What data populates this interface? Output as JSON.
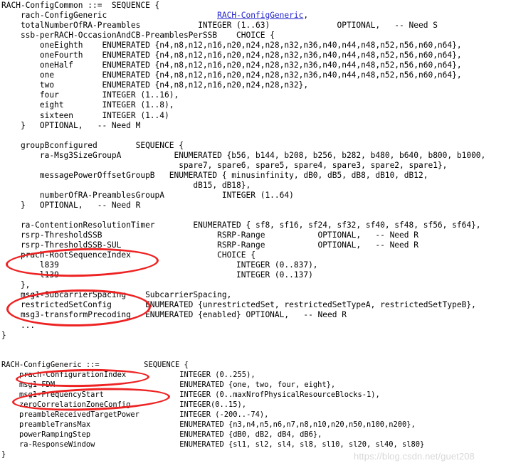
{
  "document": {
    "kind": "asn1-specification",
    "watermark": "https://blog.csdn.net/guet208",
    "annotation_color": "#ee2222",
    "link_color": "#2222cc",
    "text_color": "#000000",
    "background_color": "#ffffff"
  },
  "blocks": {
    "rach_config_common": {
      "name": "RACH-ConfigCommon",
      "lines": [
        "RACH-ConfigCommon ::=  SEQUENCE {",
        "    rach-ConfigGeneric                       ",
        "    totalNumberOfRA-Preambles            INTEGER (1..63)              OPTIONAL,   -- Need S",
        "    ssb-perRACH-OccasionAndCB-PreamblesPerSSB    CHOICE {",
        "        oneEighth    ENUMERATED {n4,n8,n12,n16,n20,n24,n28,n32,n36,n40,n44,n48,n52,n56,n60,n64},",
        "        oneFourth    ENUMERATED {n4,n8,n12,n16,n20,n24,n28,n32,n36,n40,n44,n48,n52,n56,n60,n64},",
        "        oneHalf      ENUMERATED {n4,n8,n12,n16,n20,n24,n28,n32,n36,n40,n44,n48,n52,n56,n60,n64},",
        "        one          ENUMERATED {n4,n8,n12,n16,n20,n24,n28,n32,n36,n40,n44,n48,n52,n56,n60,n64},",
        "        two          ENUMERATED {n4,n8,n12,n16,n20,n24,n28,n32},",
        "        four         INTEGER (1..16),",
        "        eight        INTEGER (1..8),",
        "        sixteen      INTEGER (1..4)",
        "    }   OPTIONAL,   -- Need M",
        "",
        "    groupBconfigured        SEQUENCE {",
        "        ra-Msg3SizeGroupA           ENUMERATED {b56, b144, b208, b256, b282, b480, b640, b800, b1000,",
        "                                     spare7, spare6, spare5, spare4, spare3, spare2, spare1},",
        "        messagePowerOffsetGroupB   ENUMERATED { minusinfinity, dB0, dB5, dB8, dB10, dB12,",
        "                                        dB15, dB18},",
        "        numberOfRA-PreamblesGroupA            INTEGER (1..64)",
        "    }   OPTIONAL,   -- Need R",
        "",
        "    ra-ContentionResolutionTimer        ENUMERATED { sf8, sf16, sf24, sf32, sf40, sf48, sf56, sf64},",
        "    rsrp-ThresholdSSB                        RSRP-Range           OPTIONAL,   -- Need R",
        "    rsrp-ThresholdSSB-SUL                    RSRP-Range           OPTIONAL,   -- Need R",
        "    prach-RootSequenceIndex                  CHOICE {",
        "        l839                                     INTEGER (0..837),",
        "        l139                                     INTEGER (0..137)",
        "    },",
        "    msg1-SubcarrierSpacing    SubcarrierSpacing,",
        "    restrictedSetConfig       ENUMERATED {unrestrictedSet, restrictedSetTypeA, restrictedSetTypeB},",
        "    msg3-transformPrecoding   ENUMERATED {enabled} OPTIONAL,   -- Need R",
        "    ...",
        "}"
      ],
      "link_line_index": 1,
      "link_prefix": "    rach-ConfigGeneric                       ",
      "link_text": "RACH-ConfigGeneric",
      "link_suffix": ","
    },
    "rach_config_generic": {
      "name": "RACH-ConfigGeneric",
      "lines": [
        "RACH-ConfigGeneric ::=          SEQUENCE {",
        "    prach-ConfigurationIndex            INTEGER (0..255),",
        "    msg1-FDM                            ENUMERATED {one, two, four, eight},",
        "    msg1-FrequencyStart                 INTEGER (0..maxNrofPhysicalResourceBlocks-1),",
        "    zeroCorrelationZoneConfig           INTEGER(0..15),",
        "    preambleReceivedTargetPower         INTEGER (-200..-74),",
        "    preambleTransMax                    ENUMERATED {n3,n4,n5,n6,n7,n8,n10,n20,n50,n100,n200},",
        "    powerRampingStep                    ENUMERATED {dB0, dB2, dB4, dB6},",
        "    ra-ResponseWindow                   ENUMERATED {sl1, sl2, sl4, sl8, sl10, sl20, sl40, sl80}",
        "}"
      ]
    }
  },
  "annotations": [
    {
      "id": "ellipse-prach-root",
      "target_label": "prach-RootSequenceIndex / l839 / l139",
      "shape": "ellipse"
    },
    {
      "id": "ellipse-restricted",
      "target_label": "msg1-SubcarrierSpacing / restrictedSetConfig / msg3-transformPrecoding",
      "shape": "ellipse"
    },
    {
      "id": "ellipse-prach-cfg",
      "target_label": "prach-ConfigurationIndex",
      "shape": "ellipse"
    },
    {
      "id": "ellipse-zerocorr",
      "target_label": "msg1-FrequencyStart / zeroCorrelationZoneConfig",
      "shape": "ellipse"
    }
  ]
}
